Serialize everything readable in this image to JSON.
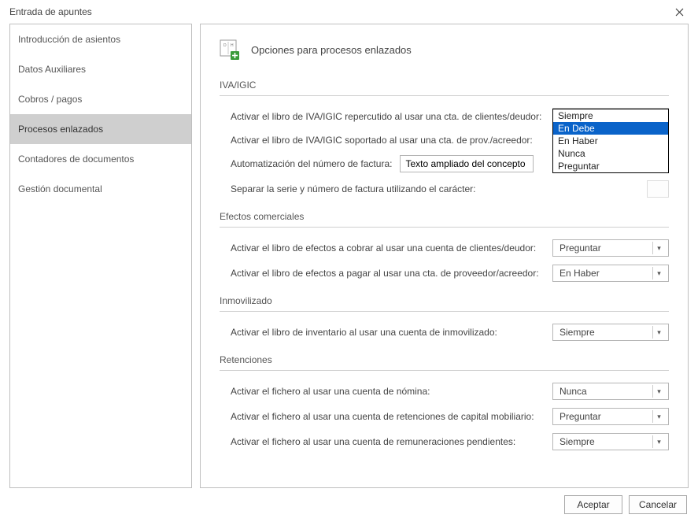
{
  "window": {
    "title": "Entrada de apuntes"
  },
  "sidebar": {
    "items": [
      {
        "label": "Introducción de asientos"
      },
      {
        "label": "Datos Auxiliares"
      },
      {
        "label": "Cobros / pagos"
      },
      {
        "label": "Procesos enlazados"
      },
      {
        "label": "Contadores de documentos"
      },
      {
        "label": "Gestión documental"
      }
    ],
    "selected_index": 3
  },
  "content": {
    "title": "Opciones para procesos enlazados",
    "sections": {
      "iva": {
        "header": "IVA/IGIC",
        "row1": {
          "label": "Activar el libro de IVA/IGIC repercutido al usar una cta. de clientes/deudor:",
          "value": "Siempre"
        },
        "row2": {
          "label": "Activar el libro de IVA/IGIC soportado al usar una cta. de prov./acreedor:"
        },
        "row3": {
          "label": "Automatización del número de factura:",
          "input_value": "Texto ampliado del concepto"
        },
        "row4": {
          "label": "Separar la serie y número de factura utilizando el carácter:"
        }
      },
      "efectos": {
        "header": "Efectos comerciales",
        "row1": {
          "label": "Activar el libro de efectos a cobrar al usar una cuenta de clientes/deudor:",
          "value": "Preguntar"
        },
        "row2": {
          "label": "Activar el libro de efectos a pagar al usar una cta. de proveedor/acreedor:",
          "value": "En Haber"
        }
      },
      "inmov": {
        "header": "Inmovilizado",
        "row1": {
          "label": "Activar el libro de inventario al usar una cuenta de inmovilizado:",
          "value": "Siempre"
        }
      },
      "retenciones": {
        "header": "Retenciones",
        "row1": {
          "label": "Activar el fichero al usar una cuenta de nómina:",
          "value": "Nunca"
        },
        "row2": {
          "label": "Activar el fichero al usar una cuenta de retenciones de capital mobiliario:",
          "value": "Preguntar"
        },
        "row3": {
          "label": "Activar el fichero al usar una cuenta de remuneraciones pendientes:",
          "value": "Siempre"
        }
      }
    }
  },
  "dropdown": {
    "options": [
      "Siempre",
      "En Debe",
      "En Haber",
      "Nunca",
      "Preguntar"
    ],
    "highlighted_index": 1
  },
  "footer": {
    "accept": "Aceptar",
    "cancel": "Cancelar"
  }
}
